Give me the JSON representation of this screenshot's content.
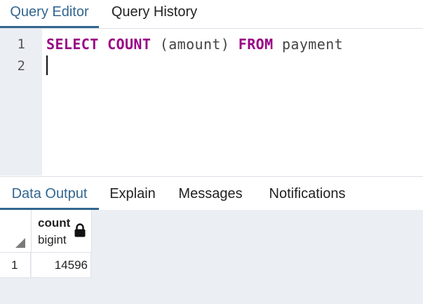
{
  "editor_tabs": [
    {
      "label": "Query Editor",
      "active": true
    },
    {
      "label": "Query History",
      "active": false
    }
  ],
  "editor": {
    "line_numbers": [
      "1",
      "2"
    ],
    "query": {
      "keyword_select": "SELECT",
      "keyword_count": "COUNT",
      "args": "(amount)",
      "keyword_from": "FROM",
      "table": "payment"
    }
  },
  "output_tabs": [
    {
      "label": "Data Output",
      "active": true
    },
    {
      "label": "Explain",
      "active": false
    },
    {
      "label": "Messages",
      "active": false
    },
    {
      "label": "Notifications",
      "active": false
    }
  ],
  "result_grid": {
    "columns": [
      {
        "name": "count",
        "type": "bigint",
        "icon": "lock-icon"
      }
    ],
    "rows": [
      {
        "row_number": "1",
        "values": [
          "14596"
        ]
      }
    ]
  },
  "colors": {
    "accent": "#326690",
    "keyword": "#990085",
    "gutter_bg": "#ebeef3"
  }
}
